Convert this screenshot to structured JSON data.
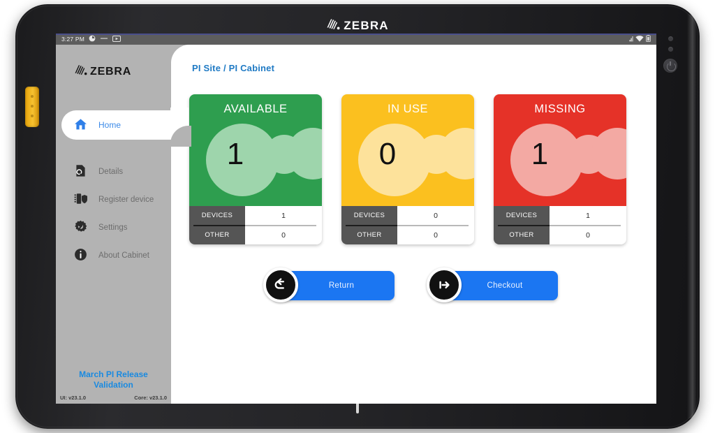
{
  "device": {
    "brand_logo": "ZEBRA",
    "brand_mark": "zebra-head-icon"
  },
  "status_bar": {
    "time": "3:27 PM",
    "left_icons": [
      "sync-circle-icon",
      "dash-icon",
      "screenshot-icon"
    ],
    "right_icons": [
      "signal-icon",
      "wifi-icon",
      "battery-icon"
    ]
  },
  "sidebar": {
    "logo_text": "ZEBRA",
    "items": [
      {
        "label": "Home",
        "icon": "home-icon",
        "active": true
      },
      {
        "label": "Details",
        "icon": "document-search-icon",
        "active": false
      },
      {
        "label": "Register device",
        "icon": "register-device-icon",
        "active": false
      },
      {
        "label": "Settings",
        "icon": "gear-wrench-icon",
        "active": false
      },
      {
        "label": "About Cabinet",
        "icon": "info-icon",
        "active": false
      }
    ],
    "footer": {
      "release_line1": "March PI Release",
      "release_line2": "Validation",
      "ui_version": "UI: v23.1.0",
      "core_version": "Core: v23.1.0"
    }
  },
  "content": {
    "breadcrumb": "PI Site / PI Cabinet",
    "cards": [
      {
        "title": "AVAILABLE",
        "value": "1",
        "color": "#2e9e4f",
        "blob_color": "#9ed5ac",
        "rows": [
          {
            "key": "DEVICES",
            "value": "1"
          },
          {
            "key": "OTHER",
            "value": "0"
          }
        ]
      },
      {
        "title": "IN USE",
        "value": "0",
        "color": "#fbc01f",
        "blob_color": "#fde29b",
        "rows": [
          {
            "key": "DEVICES",
            "value": "0"
          },
          {
            "key": "OTHER",
            "value": "0"
          }
        ]
      },
      {
        "title": "MISSING",
        "value": "1",
        "color": "#e53228",
        "blob_color": "#f3a9a3",
        "rows": [
          {
            "key": "DEVICES",
            "value": "1"
          },
          {
            "key": "OTHER",
            "value": "0"
          }
        ]
      }
    ],
    "actions": [
      {
        "label": "Return",
        "icon": "return-arrow-icon",
        "color": "#1b76f2"
      },
      {
        "label": "Checkout",
        "icon": "checkout-arrow-icon",
        "color": "#1b76f2"
      }
    ]
  },
  "colors": {
    "accent_blue": "#1b76f2",
    "breadcrumb_blue": "#1f7ac4",
    "sidebar_gray": "#b3b3b3",
    "footer_gray": "#555555"
  }
}
